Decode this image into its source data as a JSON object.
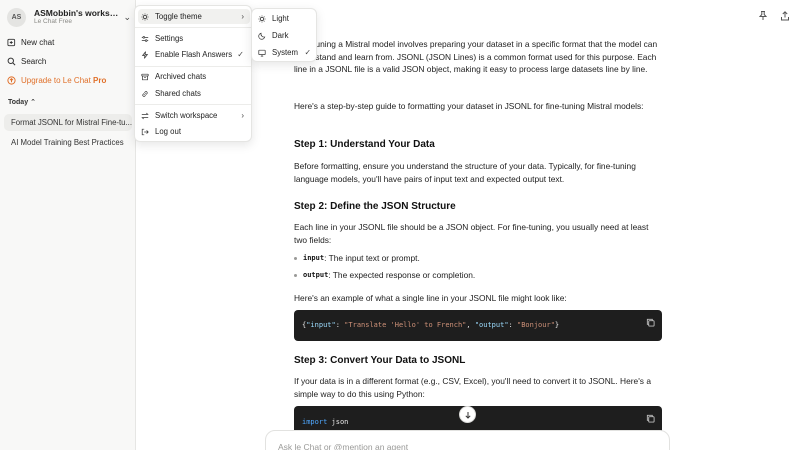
{
  "sidebar": {
    "avatar_initials": "AS",
    "workspace_name": "ASMobbin's worksp...",
    "workspace_plan": "Le Chat Free",
    "new_chat": "New chat",
    "search": "Search",
    "upgrade_prefix": "Upgrade to Le Chat ",
    "upgrade_pro": "Pro",
    "section_today": "Today",
    "chats": [
      {
        "title": "Format JSONL for Mistral Fine-tu..."
      },
      {
        "title": "AI Model Training Best Practices"
      }
    ]
  },
  "menu": {
    "toggle_theme": "Toggle theme",
    "settings": "Settings",
    "flash_answers": "Enable Flash Answers",
    "archived": "Archived chats",
    "shared": "Shared chats",
    "switch_workspace": "Switch workspace",
    "logout": "Log out"
  },
  "theme_menu": {
    "light": "Light",
    "dark": "Dark",
    "system": "System"
  },
  "content": {
    "intro": "Fine-tuning a Mistral model involves preparing your dataset in a specific format that the model can understand and learn from. JSONL (JSON Lines) is a common format used for this purpose. Each line in a JSONL file is a valid JSON object, making it easy to process large datasets line by line.",
    "guide": "Here's a step-by-step guide to formatting your dataset in JSONL for fine-tuning Mistral models:",
    "step1_title": "Step 1: Understand Your Data",
    "step1_body": "Before formatting, ensure you understand the structure of your data. Typically, for fine-tuning language models, you'll have pairs of input text and expected output text.",
    "step2_title": "Step 2: Define the JSON Structure",
    "step2_body": "Each line in your JSONL file should be a JSON object. For fine-tuning, you usually need at least two fields:",
    "bullets": [
      {
        "code": "input",
        "text": ": The input text or prompt."
      },
      {
        "code": "output",
        "text": ": The expected response or completion."
      }
    ],
    "example_intro": "Here's an example of what a single line in your JSONL file might look like:",
    "code1": {
      "brace_open": "{",
      "k1": "\"input\"",
      "colon1": ": ",
      "v1": "\"Translate 'Hello' to French\"",
      "comma": ", ",
      "k2": "\"output\"",
      "colon2": ": ",
      "v2": "\"Bonjour\"",
      "brace_close": "}"
    },
    "step3_title": "Step 3: Convert Your Data to JSONL",
    "step3_body": "If your data is in a different format (e.g., CSV, Excel), you'll need to convert it to JSONL. Here's a simple way to do this using Python:",
    "code2": {
      "kw": "import",
      "mod": " json"
    }
  },
  "input": {
    "placeholder": "Ask le Chat or @mention an agent"
  }
}
